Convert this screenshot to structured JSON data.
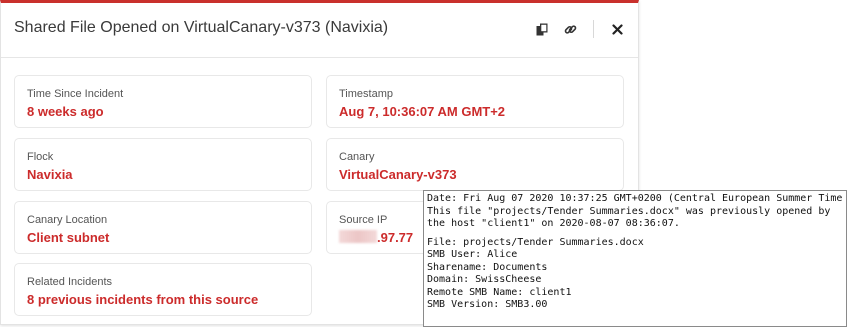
{
  "modal": {
    "title": "Shared File Opened on VirtualCanary-v373 (Navixia)",
    "actions": [
      {
        "name": "copy-icon"
      },
      {
        "name": "link-icon"
      },
      {
        "name": "close-icon"
      }
    ]
  },
  "cards": {
    "time_since": {
      "label": "Time Since Incident",
      "value": "8 weeks ago"
    },
    "timestamp": {
      "label": "Timestamp",
      "value": "Aug 7, 10:36:07 AM GMT+2"
    },
    "flock": {
      "label": "Flock",
      "value": "Navixia"
    },
    "canary": {
      "label": "Canary",
      "value": "VirtualCanary-v373"
    },
    "location": {
      "label": "Canary Location",
      "value": "Client subnet"
    },
    "source_ip": {
      "label": "Source IP",
      "value_visible": ".97.77"
    },
    "related": {
      "label": "Related Incidents",
      "value": "8 previous incidents from this source"
    }
  },
  "log": {
    "lines_top": [
      "Date: Fri Aug 07 2020 10:37:25 GMT+0200 (Central European Summer Time",
      "This file \"projects/Tender Summaries.docx\" was previously opened by",
      "the host \"client1\" on 2020-08-07 08:36:07."
    ],
    "lines_bottom": [
      "File: projects/Tender Summaries.docx",
      "SMB User: Alice",
      "Sharename: Documents",
      "Domain: SwissCheese",
      "Remote SMB Name: client1",
      "SMB Version: SMB3.00"
    ]
  },
  "colors": {
    "accent_red": "#cc2b2b",
    "top_border": "#c9302c"
  }
}
